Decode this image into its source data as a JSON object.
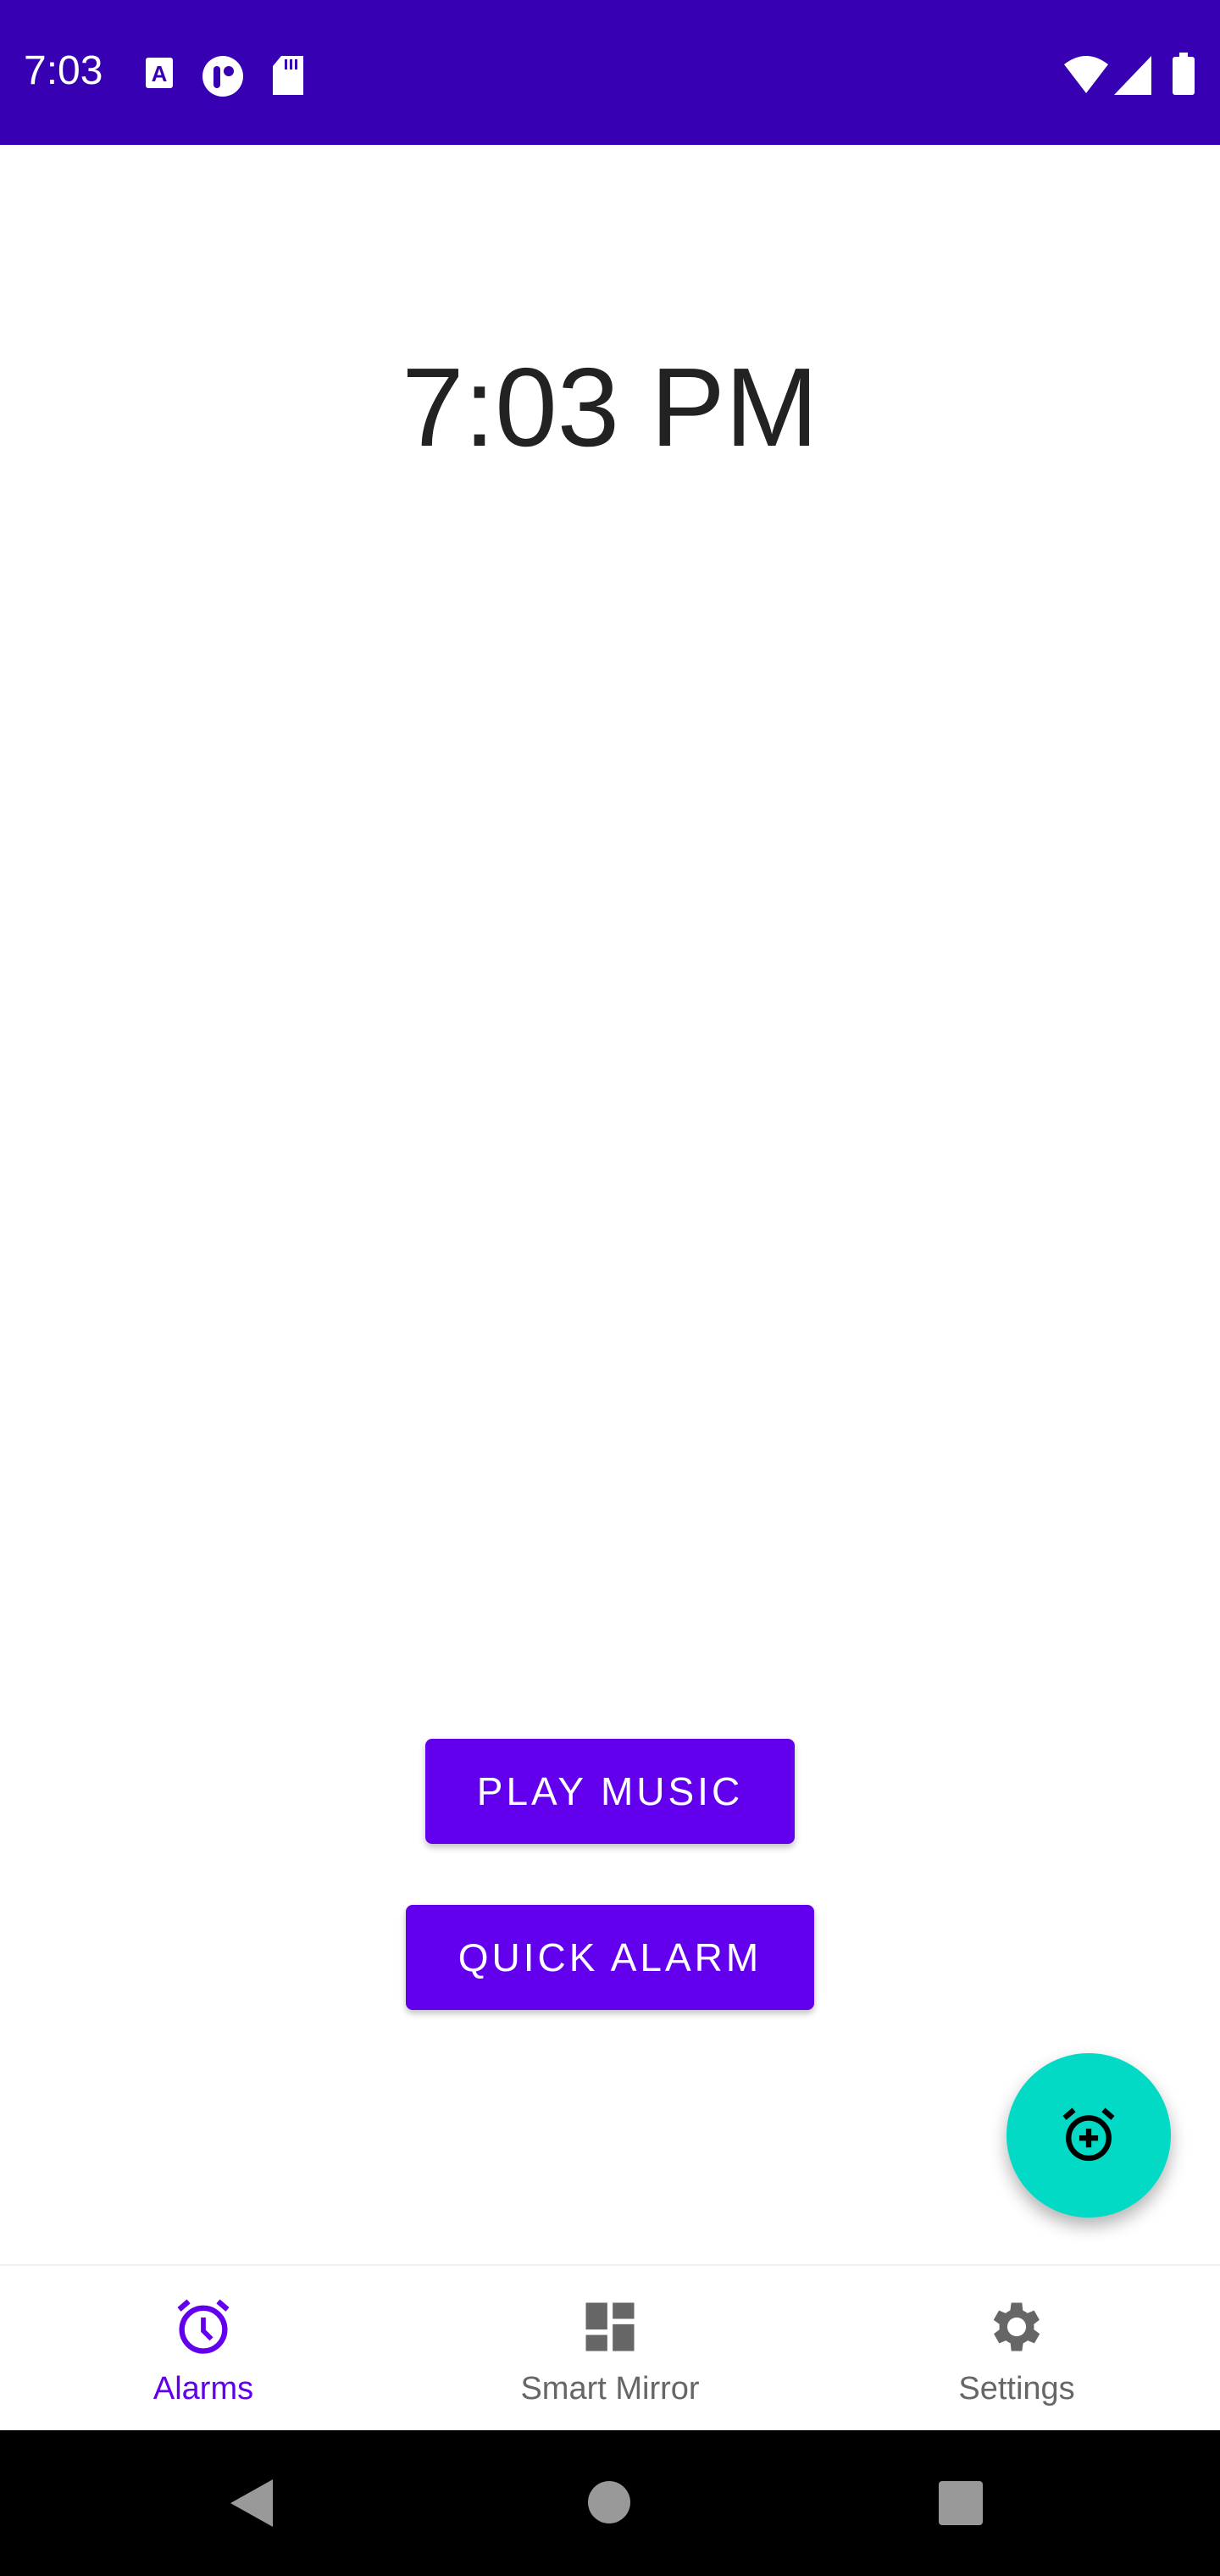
{
  "status_bar": {
    "time": "7:03",
    "icons": [
      "a-icon",
      "t-icon",
      "sd-card-icon",
      "wifi-icon",
      "signal-icon",
      "battery-icon"
    ],
    "background": "#3700b3"
  },
  "main": {
    "clock": "7:03 PM",
    "play_music_label": "PLAY MUSIC",
    "quick_alarm_label": "QUICK ALARM",
    "accent": "#6200ee"
  },
  "fab": {
    "icon": "add-alarm-icon",
    "color": "#03dac5"
  },
  "bottom_nav": {
    "items": [
      {
        "label": "Alarms",
        "icon": "alarm-icon",
        "active": true
      },
      {
        "label": "Smart Mirror",
        "icon": "dashboard-icon",
        "active": false
      },
      {
        "label": "Settings",
        "icon": "gear-icon",
        "active": false
      }
    ]
  },
  "system_nav": {
    "icons": [
      "back-icon",
      "home-icon",
      "recents-icon"
    ]
  }
}
